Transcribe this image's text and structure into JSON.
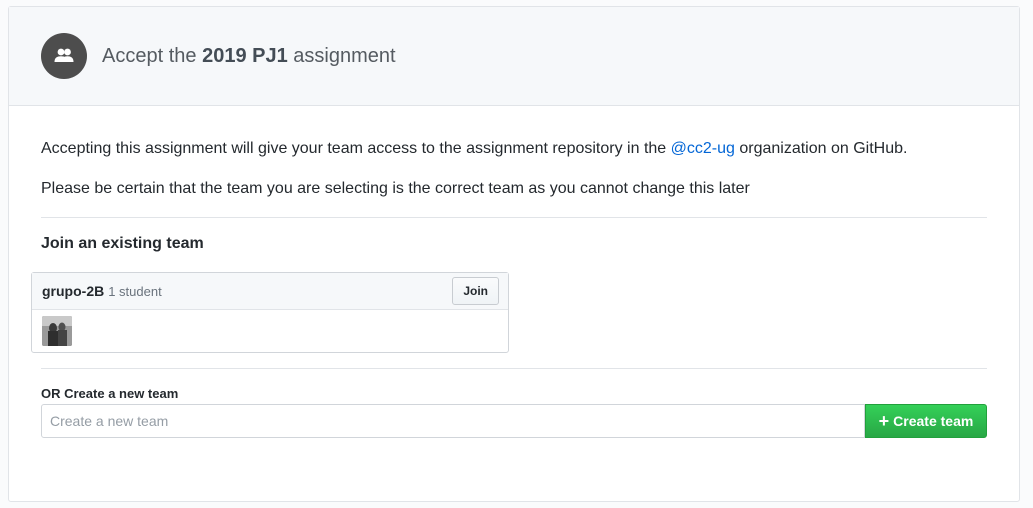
{
  "header": {
    "title_prefix": "Accept the",
    "assignment_name": "2019 PJ1",
    "title_suffix": "assignment",
    "icon": "people-icon"
  },
  "intro": {
    "text_before": "Accepting this assignment will give your team access to the assignment repository in the",
    "org_link": "@cc2-ug",
    "text_after": "organization on GitHub.",
    "warning": "Please be certain that the team you are selecting is the correct team as you cannot change this later"
  },
  "join_section": {
    "title": "Join an existing team",
    "teams": [
      {
        "name": "grupo-2B",
        "count": "1 student",
        "join_label": "Join"
      }
    ]
  },
  "create_section": {
    "label": "OR Create a new team",
    "placeholder": "Create a new team",
    "button_label": "Create team",
    "button_icon": "plus-icon"
  },
  "colors": {
    "link": "#0366d6",
    "create_button": "#28a745",
    "header_bg": "#f6f8fa"
  }
}
